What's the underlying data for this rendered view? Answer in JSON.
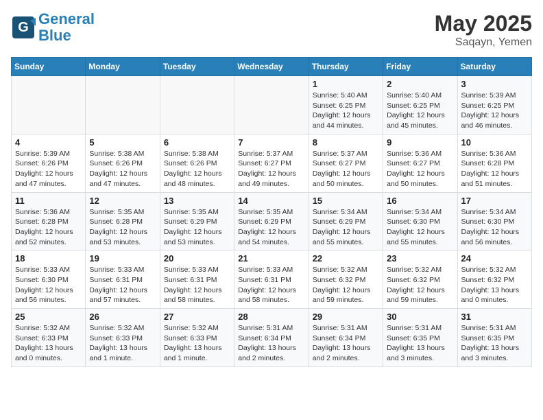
{
  "header": {
    "logo_line1": "General",
    "logo_line2": "Blue",
    "month_year": "May 2025",
    "location": "Saqayn, Yemen"
  },
  "weekdays": [
    "Sunday",
    "Monday",
    "Tuesday",
    "Wednesday",
    "Thursday",
    "Friday",
    "Saturday"
  ],
  "weeks": [
    [
      {
        "day": "",
        "info": ""
      },
      {
        "day": "",
        "info": ""
      },
      {
        "day": "",
        "info": ""
      },
      {
        "day": "",
        "info": ""
      },
      {
        "day": "1",
        "info": "Sunrise: 5:40 AM\nSunset: 6:25 PM\nDaylight: 12 hours\nand 44 minutes."
      },
      {
        "day": "2",
        "info": "Sunrise: 5:40 AM\nSunset: 6:25 PM\nDaylight: 12 hours\nand 45 minutes."
      },
      {
        "day": "3",
        "info": "Sunrise: 5:39 AM\nSunset: 6:25 PM\nDaylight: 12 hours\nand 46 minutes."
      }
    ],
    [
      {
        "day": "4",
        "info": "Sunrise: 5:39 AM\nSunset: 6:26 PM\nDaylight: 12 hours\nand 47 minutes."
      },
      {
        "day": "5",
        "info": "Sunrise: 5:38 AM\nSunset: 6:26 PM\nDaylight: 12 hours\nand 47 minutes."
      },
      {
        "day": "6",
        "info": "Sunrise: 5:38 AM\nSunset: 6:26 PM\nDaylight: 12 hours\nand 48 minutes."
      },
      {
        "day": "7",
        "info": "Sunrise: 5:37 AM\nSunset: 6:27 PM\nDaylight: 12 hours\nand 49 minutes."
      },
      {
        "day": "8",
        "info": "Sunrise: 5:37 AM\nSunset: 6:27 PM\nDaylight: 12 hours\nand 50 minutes."
      },
      {
        "day": "9",
        "info": "Sunrise: 5:36 AM\nSunset: 6:27 PM\nDaylight: 12 hours\nand 50 minutes."
      },
      {
        "day": "10",
        "info": "Sunrise: 5:36 AM\nSunset: 6:28 PM\nDaylight: 12 hours\nand 51 minutes."
      }
    ],
    [
      {
        "day": "11",
        "info": "Sunrise: 5:36 AM\nSunset: 6:28 PM\nDaylight: 12 hours\nand 52 minutes."
      },
      {
        "day": "12",
        "info": "Sunrise: 5:35 AM\nSunset: 6:28 PM\nDaylight: 12 hours\nand 53 minutes."
      },
      {
        "day": "13",
        "info": "Sunrise: 5:35 AM\nSunset: 6:29 PM\nDaylight: 12 hours\nand 53 minutes."
      },
      {
        "day": "14",
        "info": "Sunrise: 5:35 AM\nSunset: 6:29 PM\nDaylight: 12 hours\nand 54 minutes."
      },
      {
        "day": "15",
        "info": "Sunrise: 5:34 AM\nSunset: 6:29 PM\nDaylight: 12 hours\nand 55 minutes."
      },
      {
        "day": "16",
        "info": "Sunrise: 5:34 AM\nSunset: 6:30 PM\nDaylight: 12 hours\nand 55 minutes."
      },
      {
        "day": "17",
        "info": "Sunrise: 5:34 AM\nSunset: 6:30 PM\nDaylight: 12 hours\nand 56 minutes."
      }
    ],
    [
      {
        "day": "18",
        "info": "Sunrise: 5:33 AM\nSunset: 6:30 PM\nDaylight: 12 hours\nand 56 minutes."
      },
      {
        "day": "19",
        "info": "Sunrise: 5:33 AM\nSunset: 6:31 PM\nDaylight: 12 hours\nand 57 minutes."
      },
      {
        "day": "20",
        "info": "Sunrise: 5:33 AM\nSunset: 6:31 PM\nDaylight: 12 hours\nand 58 minutes."
      },
      {
        "day": "21",
        "info": "Sunrise: 5:33 AM\nSunset: 6:31 PM\nDaylight: 12 hours\nand 58 minutes."
      },
      {
        "day": "22",
        "info": "Sunrise: 5:32 AM\nSunset: 6:32 PM\nDaylight: 12 hours\nand 59 minutes."
      },
      {
        "day": "23",
        "info": "Sunrise: 5:32 AM\nSunset: 6:32 PM\nDaylight: 12 hours\nand 59 minutes."
      },
      {
        "day": "24",
        "info": "Sunrise: 5:32 AM\nSunset: 6:32 PM\nDaylight: 13 hours\nand 0 minutes."
      }
    ],
    [
      {
        "day": "25",
        "info": "Sunrise: 5:32 AM\nSunset: 6:33 PM\nDaylight: 13 hours\nand 0 minutes."
      },
      {
        "day": "26",
        "info": "Sunrise: 5:32 AM\nSunset: 6:33 PM\nDaylight: 13 hours\nand 1 minute."
      },
      {
        "day": "27",
        "info": "Sunrise: 5:32 AM\nSunset: 6:33 PM\nDaylight: 13 hours\nand 1 minute."
      },
      {
        "day": "28",
        "info": "Sunrise: 5:31 AM\nSunset: 6:34 PM\nDaylight: 13 hours\nand 2 minutes."
      },
      {
        "day": "29",
        "info": "Sunrise: 5:31 AM\nSunset: 6:34 PM\nDaylight: 13 hours\nand 2 minutes."
      },
      {
        "day": "30",
        "info": "Sunrise: 5:31 AM\nSunset: 6:35 PM\nDaylight: 13 hours\nand 3 minutes."
      },
      {
        "day": "31",
        "info": "Sunrise: 5:31 AM\nSunset: 6:35 PM\nDaylight: 13 hours\nand 3 minutes."
      }
    ]
  ]
}
